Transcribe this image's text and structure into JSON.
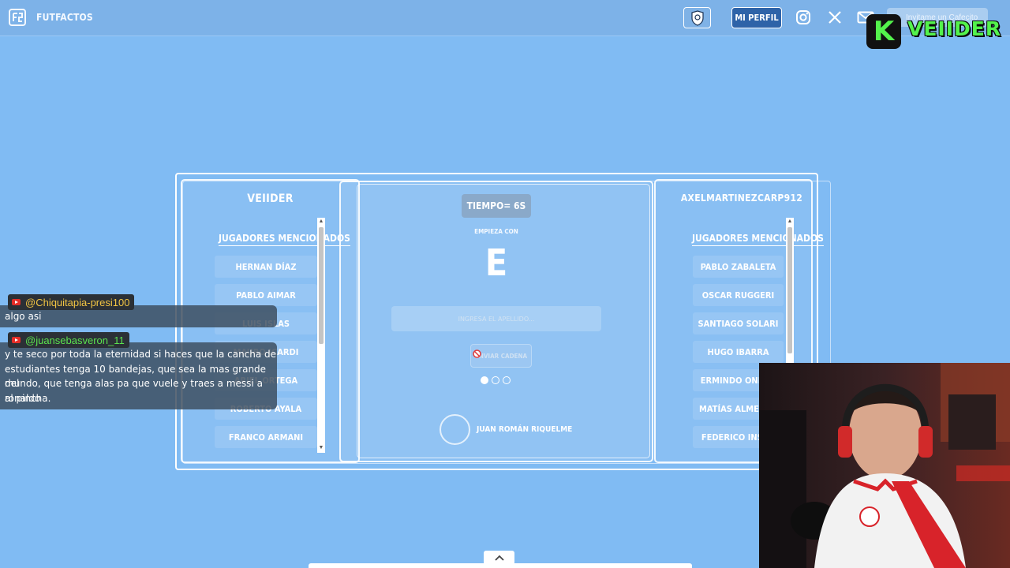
{
  "nav": {
    "brand": "FUTFACTOS",
    "profile_label": "MI PERFIL",
    "coffee_label": "Invitame un Cafecito",
    "icons": [
      "shield-icon",
      "instagram-icon",
      "x-icon",
      "mail-icon",
      "coffee-icon"
    ]
  },
  "stream_overlay": {
    "badge": "K",
    "name": "VEIIDER"
  },
  "game": {
    "left_player": {
      "name": "VEIIDER",
      "list_heading": "JUGADORES MENCIONADOS",
      "items": [
        "HERNAN DÍAZ",
        "PABLO AIMAR",
        "LUIS ISLAS",
        "MAURO ICARDI",
        "ARIEL ORTEGA",
        "ROBERTO AYALA",
        "FRANCO ARMANI"
      ]
    },
    "right_player": {
      "name": "AXELMARTINEZCARP912",
      "list_heading": "JUGADORES MENCIONADOS",
      "items": [
        "PABLO ZABALETA",
        "OSCAR RUGGERI",
        "SANTIAGO SOLARI",
        "HUGO IBARRA",
        "ERMINDO ONEGA",
        "MATÍAS ALMEYDA",
        "FEDERICO INSUA"
      ]
    },
    "timer": "TIEMPO= 6S",
    "starts_with_label": "EMPIEZA CON",
    "letter": "E",
    "input_placeholder": "INGRESA EL APELLIDO...",
    "submit_label": "ENVIAR CADENA",
    "progress": {
      "current": 1,
      "total": 3
    },
    "hint_player": "JUAN ROMÁN RIQUELME"
  },
  "chat": [
    {
      "user": "@Chiquitapia-presi100",
      "user_color": "#f2c443",
      "text": [
        "algo asi"
      ]
    },
    {
      "user": "@juansebasveron_11",
      "user_color": "#5be34f",
      "text": [
        "y te seco por toda la eternidad si haces que la cancha de",
        "estudiantes tenga 10 bandejas, que sea la mas grande del",
        "mundo, que tenga alas pa que vuele y traes a messi a ronaldo",
        "al pincha."
      ]
    }
  ],
  "colors": {
    "background": "#80bbf3",
    "nav": "#7db2e8",
    "profile_button": "#2e63a8",
    "stream_green": "#53f24c"
  }
}
